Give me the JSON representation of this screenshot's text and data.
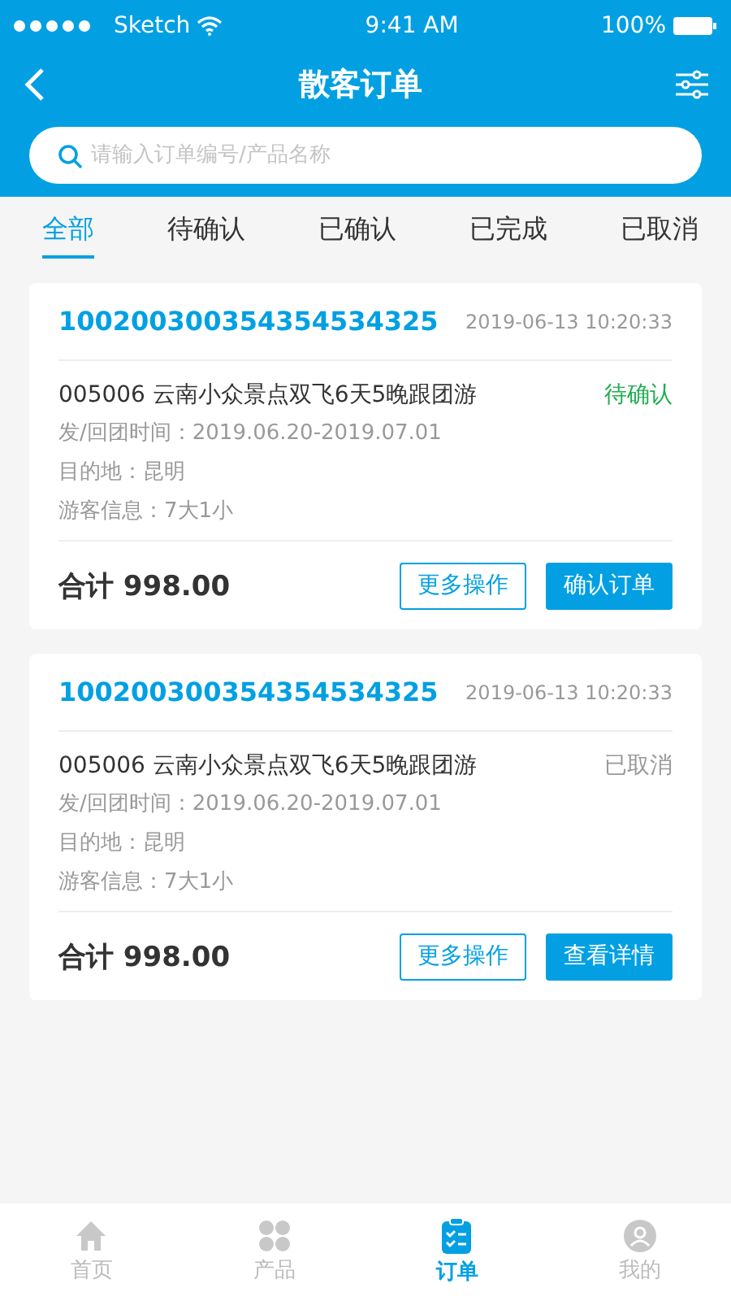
{
  "status_bar": {
    "carrier": "Sketch",
    "time": "9:41 AM",
    "battery": "100%"
  },
  "nav": {
    "title": "散客订单"
  },
  "search": {
    "placeholder": "请输入订单编号/产品名称"
  },
  "tabs": [
    {
      "label": "全部",
      "selected": true
    },
    {
      "label": "待确认",
      "selected": false
    },
    {
      "label": "已确认",
      "selected": false
    },
    {
      "label": "已完成",
      "selected": false
    },
    {
      "label": "已取消",
      "selected": false
    }
  ],
  "orders": [
    {
      "number": "100200300354354534325",
      "time": "2019-06-13 10:20:33",
      "product": "005006 云南小众景点双飞6天5晚跟团游",
      "status": {
        "text": "待确认",
        "kind": "pending"
      },
      "details": [
        "发/回团时间：2019.06.20-2019.07.01",
        "目的地：昆明",
        "游客信息：7大1小"
      ],
      "total": "合计 998.00",
      "buttons": [
        {
          "label": "更多操作",
          "kind": "outline"
        },
        {
          "label": "确认订单",
          "kind": "primary"
        }
      ]
    },
    {
      "number": "100200300354354534325",
      "time": "2019-06-13 10:20:33",
      "product": "005006 云南小众景点双飞6天5晚跟团游",
      "status": {
        "text": "已取消",
        "kind": "cancelled"
      },
      "details": [
        "发/回团时间：2019.06.20-2019.07.01",
        "目的地：昆明",
        "游客信息：7大1小"
      ],
      "total": "合计 998.00",
      "buttons": [
        {
          "label": "更多操作",
          "kind": "outline"
        },
        {
          "label": "查看详情",
          "kind": "primary"
        }
      ]
    }
  ],
  "tab_bar": [
    {
      "label": "首页",
      "kind": "home",
      "selected": false
    },
    {
      "label": "产品",
      "kind": "product",
      "selected": false
    },
    {
      "label": "订单",
      "kind": "order",
      "selected": true
    },
    {
      "label": "我的",
      "kind": "me",
      "selected": false
    }
  ]
}
